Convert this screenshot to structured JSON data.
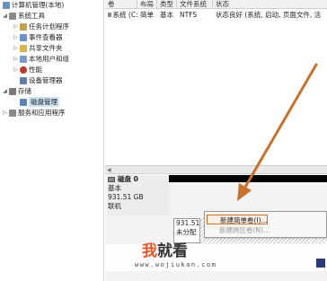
{
  "tree": {
    "items": [
      {
        "label": "计算机管理(本地)",
        "arrow": "",
        "icon_color": "#6b8fbf"
      },
      {
        "label": "系统工具",
        "arrow": "◢",
        "icon_color": "#8a8a8a"
      },
      {
        "label": "任务计划程序",
        "arrow": "▷",
        "icon_color": "#c2a24a"
      },
      {
        "label": "事件查看器",
        "arrow": "▷",
        "icon_color": "#6a8fc4"
      },
      {
        "label": "共享文件夹",
        "arrow": "▷",
        "icon_color": "#d9b44a"
      },
      {
        "label": "本地用户和组",
        "arrow": "▷",
        "icon_color": "#7b9cc9"
      },
      {
        "label": "性能",
        "arrow": "▷",
        "icon_color": "#c0392b"
      },
      {
        "label": "设备管理器",
        "arrow": "",
        "icon_color": "#5f7fa8"
      },
      {
        "label": "存储",
        "arrow": "◢",
        "icon_color": "#7a7a7a"
      },
      {
        "label": "磁盘管理",
        "arrow": "",
        "icon_color": "#5a87b8"
      },
      {
        "label": "服务和应用程序",
        "arrow": "▷",
        "icon_color": "#8a8a8a"
      }
    ]
  },
  "volumes": {
    "columns": [
      "卷",
      "布局",
      "类型",
      "文件系统",
      "状态"
    ],
    "rows": [
      {
        "volume": "系统 (C:)",
        "layout": "简单",
        "type": "基本",
        "fs": "NTFS",
        "status": "状态良好 (系统, 启动, 页面文件, 活"
      }
    ]
  },
  "disk": {
    "title": "磁盘 0",
    "kind": "基本",
    "size": "931.51 GB",
    "state": "联机",
    "partition_size": "931.51",
    "partition_state": "未分配"
  },
  "context_menu": {
    "items": [
      "新建简单卷(I)...",
      "新建跨区卷(N)..."
    ]
  },
  "watermark": {
    "logo_part1": "我",
    "logo_part2": "就看",
    "url": "www.wojiukan.com"
  },
  "colors": {
    "arrow": "#c9702a",
    "logo_accent": "#e8532b"
  }
}
